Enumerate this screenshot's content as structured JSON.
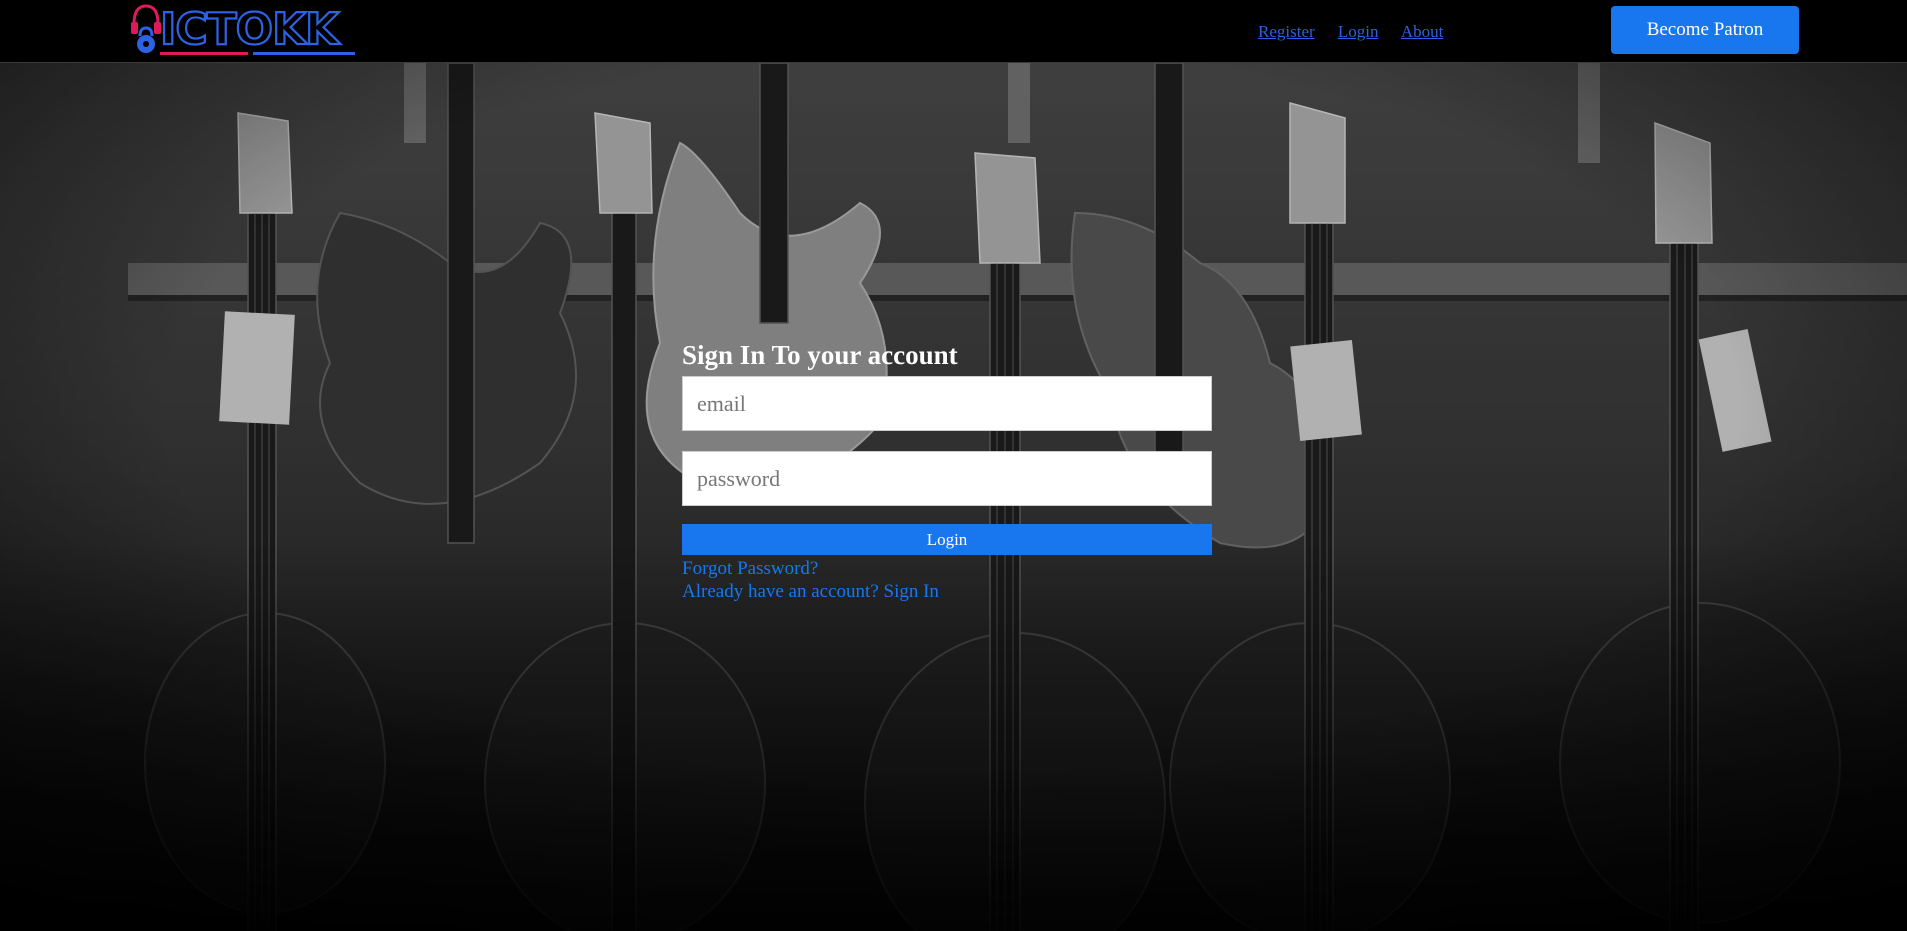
{
  "brand": {
    "logo_text": "MICTOKK",
    "logo_icon": "headphones-padlock-logo"
  },
  "nav": {
    "links": [
      {
        "label": "Register"
      },
      {
        "label": "Login"
      },
      {
        "label": "About"
      }
    ],
    "cta_label": "Become Patron"
  },
  "background": {
    "description_icon": "bass-guitars-photo"
  },
  "form": {
    "title": "Sign In To your account",
    "email_placeholder": "email",
    "password_placeholder": "password",
    "submit_label": "Login",
    "forgot_label": "Forgot Password?",
    "signin_label": "Already have an account? Sign In"
  },
  "colors": {
    "accent": "#1877ee",
    "nav_link": "#2f5ee6",
    "logo_red": "#e0195a",
    "logo_blue": "#2e62e6"
  }
}
